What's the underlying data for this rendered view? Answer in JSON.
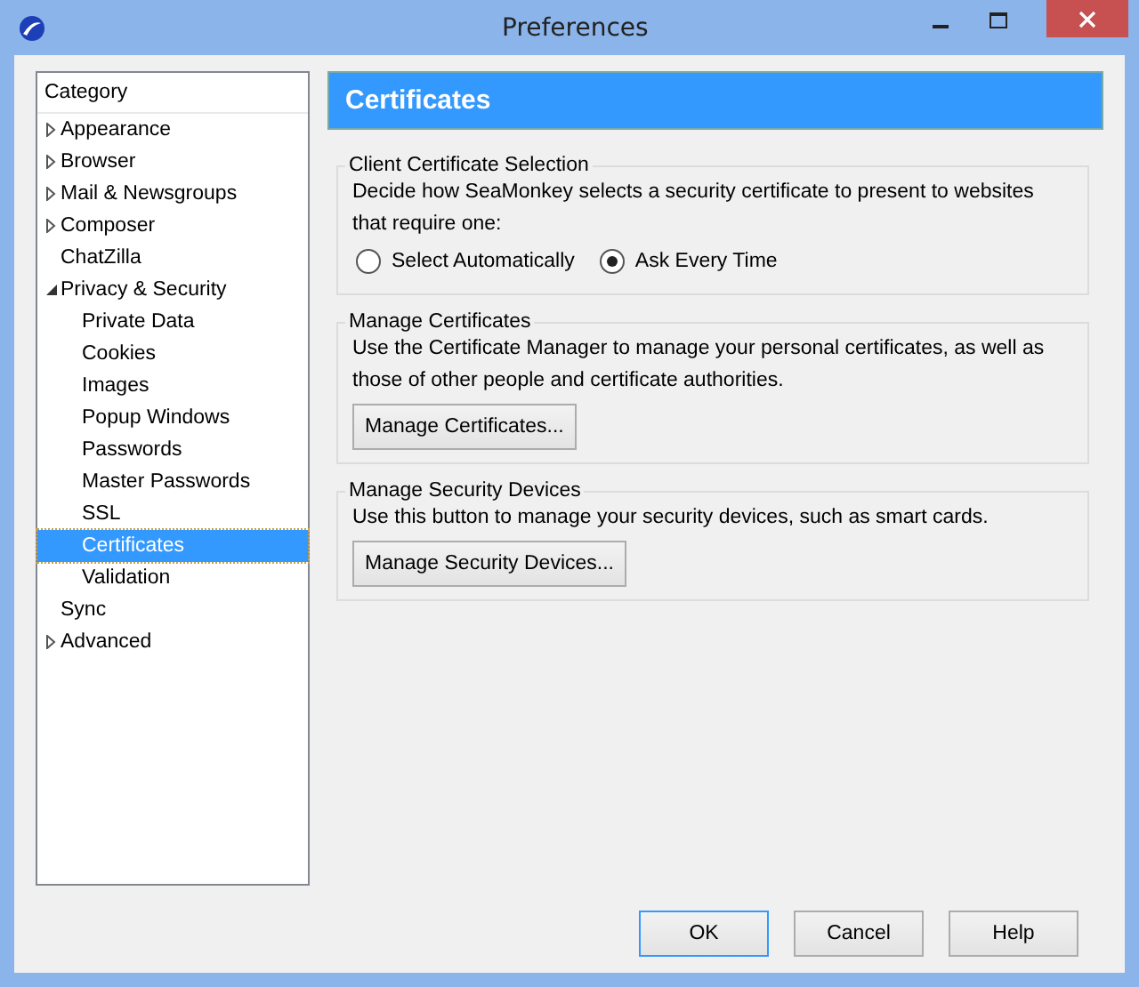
{
  "window": {
    "title": "Preferences"
  },
  "sidebar": {
    "heading": "Category",
    "items": [
      {
        "label": "Appearance",
        "expanded": false,
        "selected": false
      },
      {
        "label": "Browser",
        "expanded": false,
        "selected": false
      },
      {
        "label": "Mail & Newsgroups",
        "expanded": false,
        "selected": false
      },
      {
        "label": "Composer",
        "expanded": false,
        "selected": false
      },
      {
        "label": "ChatZilla",
        "selected": false
      },
      {
        "label": "Privacy & Security",
        "expanded": true,
        "selected": false,
        "children": [
          {
            "label": "Private Data",
            "selected": false
          },
          {
            "label": "Cookies",
            "selected": false
          },
          {
            "label": "Images",
            "selected": false
          },
          {
            "label": "Popup Windows",
            "selected": false
          },
          {
            "label": "Passwords",
            "selected": false
          },
          {
            "label": "Master Passwords",
            "selected": false
          },
          {
            "label": "SSL",
            "selected": false
          },
          {
            "label": "Certificates",
            "selected": true
          },
          {
            "label": "Validation",
            "selected": false
          }
        ]
      },
      {
        "label": "Sync",
        "selected": false
      },
      {
        "label": "Advanced",
        "expanded": false,
        "selected": false
      }
    ]
  },
  "panel": {
    "title": "Certificates",
    "groups": [
      {
        "legend": "Client Certificate Selection",
        "description": "Decide how SeaMonkey selects a security certificate to present to websites that require one:",
        "radios": [
          {
            "label": "Select Automatically",
            "selected": false
          },
          {
            "label": "Ask Every Time",
            "selected": true
          }
        ]
      },
      {
        "legend": "Manage Certificates",
        "description": "Use the Certificate Manager to manage your personal certificates, as well as those of other people and certificate authorities.",
        "button": "Manage Certificates..."
      },
      {
        "legend": "Manage Security Devices",
        "description": "Use this button to manage your security devices, such as smart cards.",
        "button": "Manage Security Devices..."
      }
    ]
  },
  "buttons": [
    {
      "label": "OK",
      "default": true
    },
    {
      "label": "Cancel",
      "default": false
    },
    {
      "label": "Help",
      "default": false
    }
  ]
}
